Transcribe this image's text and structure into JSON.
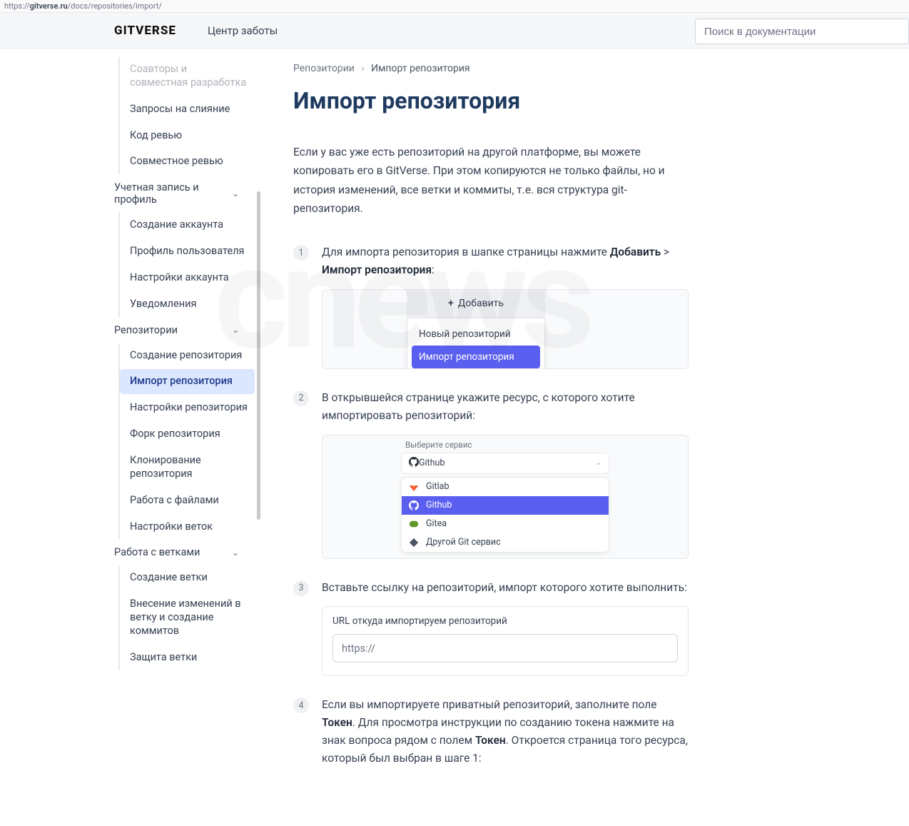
{
  "url": {
    "host": "gitverse.ru",
    "path": "/docs/repositories/import/"
  },
  "top": {
    "logo": "GITVERSE",
    "care": "Центр заботы",
    "search_ph": "Поиск в документации"
  },
  "sidebar": {
    "i0": "Соавторы и совместная разработка",
    "i1": "Запросы на слияние",
    "i2": "Код ревью",
    "i3": "Совместное ревью",
    "sec1": "Учетная запись и профиль",
    "i4": "Создание аккаунта",
    "i5": "Профиль пользователя",
    "i6": "Настройки аккаунта",
    "i7": "Уведомления",
    "sec2": "Репозитории",
    "i8": "Создание репозитория",
    "i9": "Импорт репозитория",
    "i10": "Настройки репозитория",
    "i11": "Форк репозитория",
    "i12": "Клонирование репозитория",
    "i13": "Работа с файлами",
    "i14": "Настройки веток",
    "sec3": "Работа с ветками",
    "i15": "Создание ветки",
    "i16": "Внесение изменений в ветку и создание коммитов",
    "i17": "Защита ветки"
  },
  "bc": {
    "a": "Репозитории",
    "b": "Импорт репозитория"
  },
  "h1": "Импорт репозитория",
  "intro": "Если у вас уже есть репозиторий на другой платформе, вы можете копировать его в GitVerse. При этом копируются не только файлы, но и история изменений, все ветки и коммиты, т.е. вся структура git-репозитория.",
  "s1": {
    "t1": "Для импорта репозитория в шапке страницы нажмите ",
    "b1": "Добавить",
    "sep": " > ",
    "b2": "Импорт репозитория",
    "end": ":"
  },
  "shot1": {
    "add": "Добавить",
    "o1": "Новый репозиторий",
    "o2": "Импорт репозитория"
  },
  "s2": "В открывшейся странице укажите ресурс, с которого хотите импортировать репозиторий:",
  "shot2": {
    "label": "Выберите сервис",
    "sel": "Github",
    "o1": "Gitlab",
    "o2": "Github",
    "o3": "Gitea",
    "o4": "Другой Git сервис"
  },
  "s3": "Вставьте ссылку на репозиторий, импорт которого хотите выполнить:",
  "shot3": {
    "label": "URL откуда импортируем репозиторий",
    "ph": "https://"
  },
  "s4": {
    "t1": "Если вы импортируете приватный репозиторий, заполните поле ",
    "b1": "Токен",
    "t2": ". Для просмотра инструкции по созданию токена нажмите на знак вопроса рядом с полем ",
    "b2": "Токен",
    "t3": ". Откроется страница того ресурса, который был выбран в шаге 1:"
  },
  "watermark": "cnews"
}
